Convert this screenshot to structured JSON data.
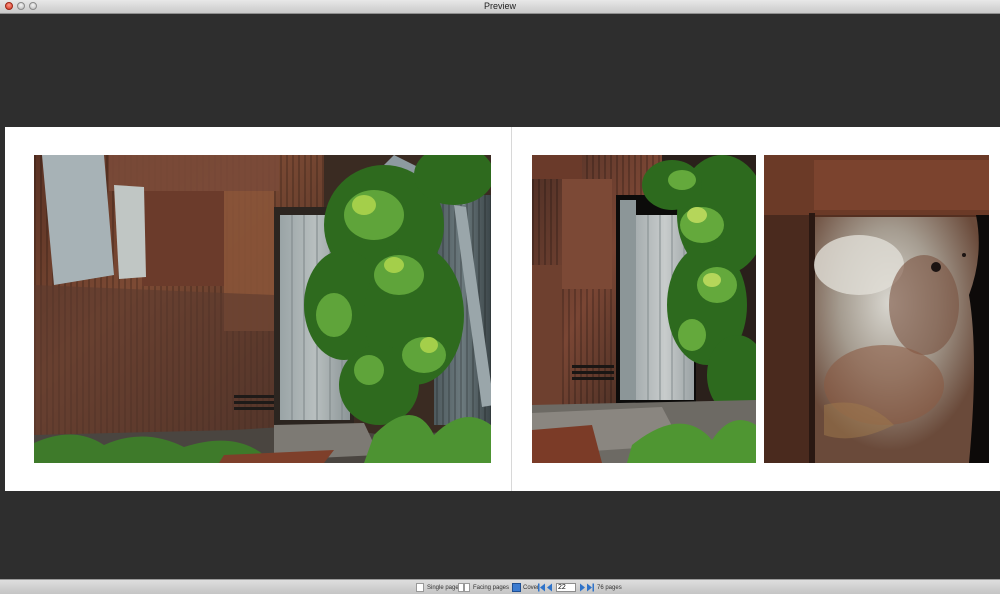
{
  "window": {
    "title": "Preview"
  },
  "status_bar": {
    "single_pages_label": "Single pages",
    "facing_pages_label": "Facing pages",
    "cover_label": "Cover",
    "current_page": "22",
    "total_pages": "76 pages"
  },
  "colors": {
    "viewer_background": "#2e2e2e",
    "page_background": "#ffffff",
    "nav_blue": "#2f73c9"
  }
}
